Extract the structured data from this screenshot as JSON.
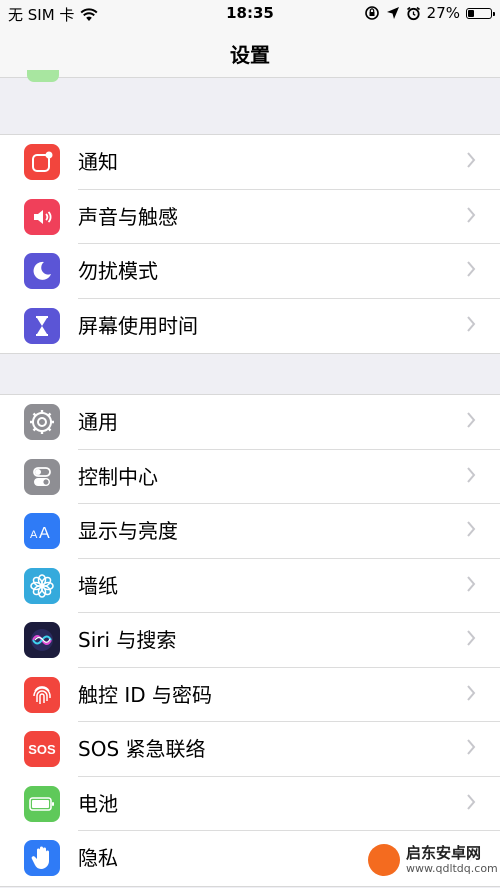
{
  "status_bar": {
    "carrier": "无 SIM 卡",
    "time": "18:35",
    "battery_percent_text": "27%",
    "battery_level": 0.27
  },
  "nav": {
    "title": "设置"
  },
  "group1": [
    {
      "label": "通知",
      "icon": "notifications-icon",
      "color": "#f2453d"
    },
    {
      "label": "声音与触感",
      "icon": "speaker-icon",
      "color": "#f0405a"
    },
    {
      "label": "勿扰模式",
      "icon": "moon-icon",
      "color": "#5b55d6"
    },
    {
      "label": "屏幕使用时间",
      "icon": "hourglass-icon",
      "color": "#5b55d6"
    }
  ],
  "group2": [
    {
      "label": "通用",
      "icon": "gear-icon",
      "color": "#8e8e93"
    },
    {
      "label": "控制中心",
      "icon": "toggles-icon",
      "color": "#8e8e93"
    },
    {
      "label": "显示与亮度",
      "icon": "text-size-icon",
      "color": "#2f7bf6"
    },
    {
      "label": "墙纸",
      "icon": "flower-icon",
      "color": "#35aadc"
    },
    {
      "label": "Siri 与搜索",
      "icon": "siri-icon",
      "color": "#1c1c3c"
    },
    {
      "label": "触控 ID 与密码",
      "icon": "fingerprint-icon",
      "color": "#f2453d"
    },
    {
      "label": "SOS 紧急联络",
      "icon": "sos-icon",
      "color": "#f2453d",
      "icon_text": "SOS"
    },
    {
      "label": "电池",
      "icon": "battery-icon",
      "color": "#5fc95a"
    },
    {
      "label": "隐私",
      "icon": "hand-icon",
      "color": "#2f7bf6"
    }
  ],
  "watermark": {
    "title": "启东安卓网",
    "url": "www.qdltdq.com"
  }
}
